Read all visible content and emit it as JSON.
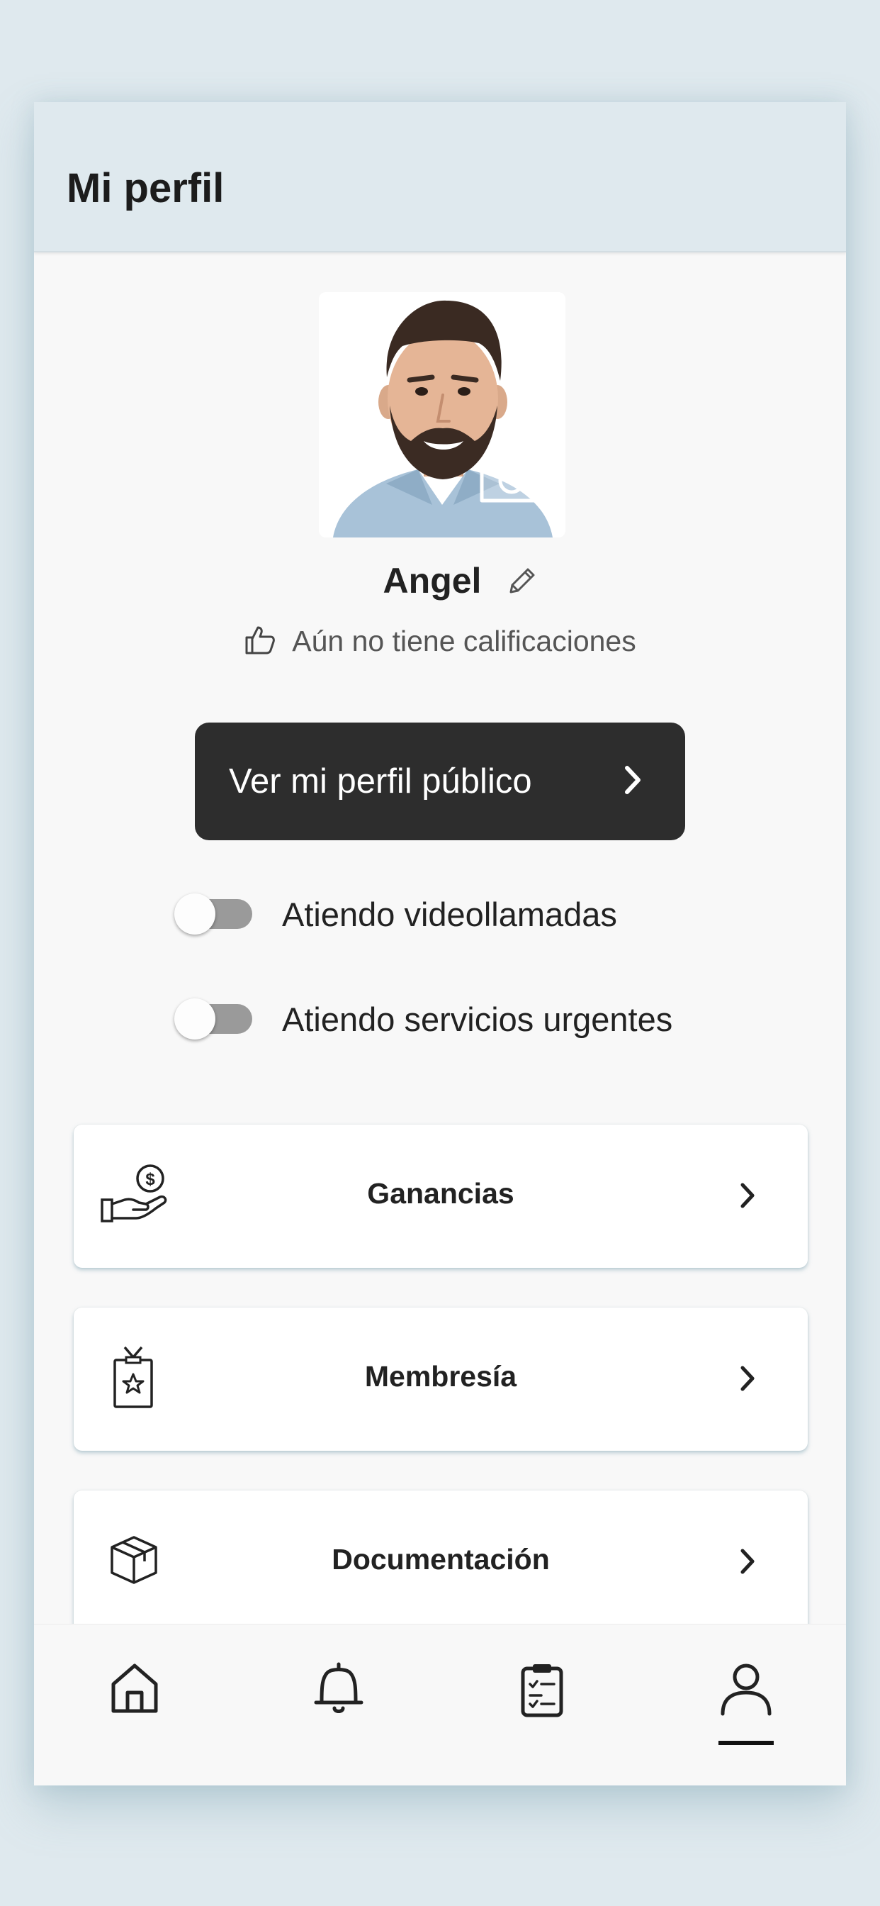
{
  "header": {
    "title": "Mi perfil"
  },
  "profile": {
    "name": "Angel",
    "rating_text": "Aún no tiene calificaciones",
    "public_profile_button": "Ver mi perfil público"
  },
  "toggles": [
    {
      "label": "Atiendo videollamadas",
      "on": false
    },
    {
      "label": "Atiendo servicios urgentes",
      "on": false
    }
  ],
  "menu": [
    {
      "label": "Ganancias",
      "icon": "money-hand-icon"
    },
    {
      "label": "Membresía",
      "icon": "membership-badge-icon"
    },
    {
      "label": "Documentación",
      "icon": "box-icon"
    }
  ],
  "bottom_nav": [
    {
      "icon": "home-icon",
      "active": false
    },
    {
      "icon": "bell-icon",
      "active": false
    },
    {
      "icon": "clipboard-icon",
      "active": false
    },
    {
      "icon": "user-icon",
      "active": true
    }
  ]
}
